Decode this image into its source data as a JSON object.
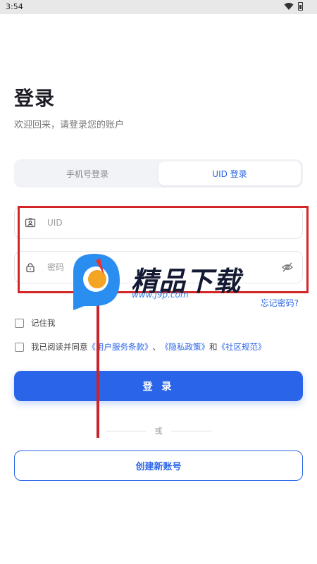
{
  "status_bar": {
    "time": "3:54"
  },
  "header": {
    "title": "登录",
    "subtitle": "欢迎回来，请登录您的账户"
  },
  "tabs": [
    {
      "label": "手机号登录",
      "active": false
    },
    {
      "label": "UID 登录",
      "active": true
    }
  ],
  "form": {
    "uid": {
      "placeholder": "UID",
      "value": ""
    },
    "password": {
      "placeholder": "密码",
      "value": ""
    },
    "forgot_label": "忘记密码?"
  },
  "remember": {
    "label": "记住我",
    "checked": false
  },
  "agreement": {
    "prefix": "我已阅读并同意",
    "terms": "《用户服务条款》",
    "sep": "、",
    "privacy": "《隐私政策》",
    "and": "和",
    "community": "《社区规范》",
    "checked": false
  },
  "login_button": "登 录",
  "divider": "或",
  "create_button": "创建新账号",
  "watermark": {
    "name": "精品下载",
    "url": "www.j9p.com"
  },
  "colors": {
    "accent": "#2a64e8",
    "annotation": "#d42626"
  }
}
